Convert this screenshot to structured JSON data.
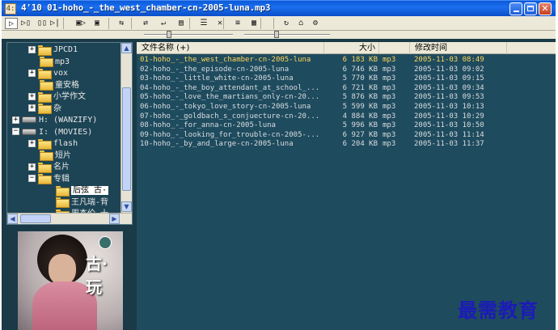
{
  "window": {
    "app_icon": "4:",
    "title": "4'10 01-hoho_-_the_west_chamber-cn-2005-luna.mp3",
    "min_icon": "minimize-icon",
    "max_icon": "maximize-icon",
    "close_label": "✕"
  },
  "toolbar": {
    "buttons": [
      {
        "name": "play-icon",
        "glyph": "▷"
      },
      {
        "name": "play-pause-icon",
        "glyph": "▷▯"
      },
      {
        "name": "pause-icon",
        "glyph": "▯▯"
      },
      {
        "name": "next-icon",
        "glyph": "▷|"
      },
      {
        "name": "folder-open-icon",
        "glyph": "▣▷"
      },
      {
        "name": "folder-icon",
        "glyph": "▣"
      },
      {
        "name": "shuffle-icon",
        "glyph": "⇆"
      },
      {
        "name": "repeat-icon",
        "glyph": "⇄"
      },
      {
        "name": "loop-icon",
        "glyph": "↵"
      },
      {
        "name": "playlist-icon",
        "glyph": "▤"
      },
      {
        "name": "list-icon",
        "glyph": "☰"
      },
      {
        "name": "delete-icon",
        "glyph": "✕"
      },
      {
        "name": "details-icon",
        "glyph": "≡"
      },
      {
        "name": "properties-icon",
        "glyph": "▦"
      },
      {
        "name": "refresh-icon",
        "glyph": "↻"
      },
      {
        "name": "home-icon",
        "glyph": "⌂"
      },
      {
        "name": "settings-icon",
        "glyph": "⚙"
      }
    ],
    "position_slider": 0.25,
    "volume_slider": 0.35
  },
  "tree": {
    "items": [
      {
        "label": "JPCD1",
        "type": "folder",
        "expander": "+"
      },
      {
        "label": "mp3",
        "type": "folder",
        "expander": ""
      },
      {
        "label": "vox",
        "type": "folder",
        "expander": "+"
      },
      {
        "label": "童安格",
        "type": "folder",
        "expander": ""
      },
      {
        "label": "小学作文",
        "type": "folder",
        "expander": "+"
      },
      {
        "label": "杂",
        "type": "folder",
        "expander": "+"
      },
      {
        "label": "H: (WANZIFY)",
        "type": "drive",
        "expander": "+"
      },
      {
        "label": "I: (MOVIES)",
        "type": "drive",
        "expander": "−"
      },
      {
        "label": "flash",
        "type": "folder",
        "expander": "+"
      },
      {
        "label": "短片",
        "type": "folder",
        "expander": ""
      },
      {
        "label": "名片",
        "type": "folder",
        "expander": "+"
      },
      {
        "label": "专辑",
        "type": "folder",
        "expander": "−"
      },
      {
        "label": "后弦 古·",
        "type": "folder",
        "expander": ""
      },
      {
        "label": "王凡瑞-背",
        "type": "folder",
        "expander": ""
      },
      {
        "label": "周杰伦 十",
        "type": "folder",
        "expander": ""
      }
    ]
  },
  "album": {
    "logo_text": "古·玩"
  },
  "list": {
    "headers": {
      "name": "文件名称 (+)",
      "size": "大小",
      "date": "修改时间"
    },
    "rows": [
      {
        "name": "01-hoho_-_the_west_chamber-cn-2005-luna",
        "size": "6 183 KB",
        "type": "mp3",
        "date": "2005-11-03 08:49",
        "playing": true
      },
      {
        "name": "02-hoho_-_the_episode-cn-2005-luna",
        "size": "6 746 KB",
        "type": "mp3",
        "date": "2005-11-03 09:02"
      },
      {
        "name": "03-hoho_-_little_white-cn-2005-luna",
        "size": "5 770 KB",
        "type": "mp3",
        "date": "2005-11-03 09:15"
      },
      {
        "name": "04-hoho_-_the_boy_attendant_at_school_...",
        "size": "6 721 KB",
        "type": "mp3",
        "date": "2005-11-03 09:34"
      },
      {
        "name": "05-hoho_-_love_the_martians_only-cn-20...",
        "size": "5 876 KB",
        "type": "mp3",
        "date": "2005-11-03 09:53"
      },
      {
        "name": "06-hoho_-_tokyo_love_story-cn-2005-luna",
        "size": "5 599 KB",
        "type": "mp3",
        "date": "2005-11-03 10:13"
      },
      {
        "name": "07-hoho_-_goldbach_s_conjuecture-cn-20...",
        "size": "4 884 KB",
        "type": "mp3",
        "date": "2005-11-03 10:29"
      },
      {
        "name": "08-hoho_-_for_anna-cn-2005-luna",
        "size": "5 996 KB",
        "type": "mp3",
        "date": "2005-11-03 10:50"
      },
      {
        "name": "09-hoho_-_looking_for_trouble-cn-2005-...",
        "size": "6 927 KB",
        "type": "mp3",
        "date": "2005-11-03 11:14"
      },
      {
        "name": "10-hoho_-_by_and_large-cn-2005-luna",
        "size": "6 204 KB",
        "type": "mp3",
        "date": "2005-11-03 11:37"
      }
    ]
  },
  "watermark": "最需教育"
}
